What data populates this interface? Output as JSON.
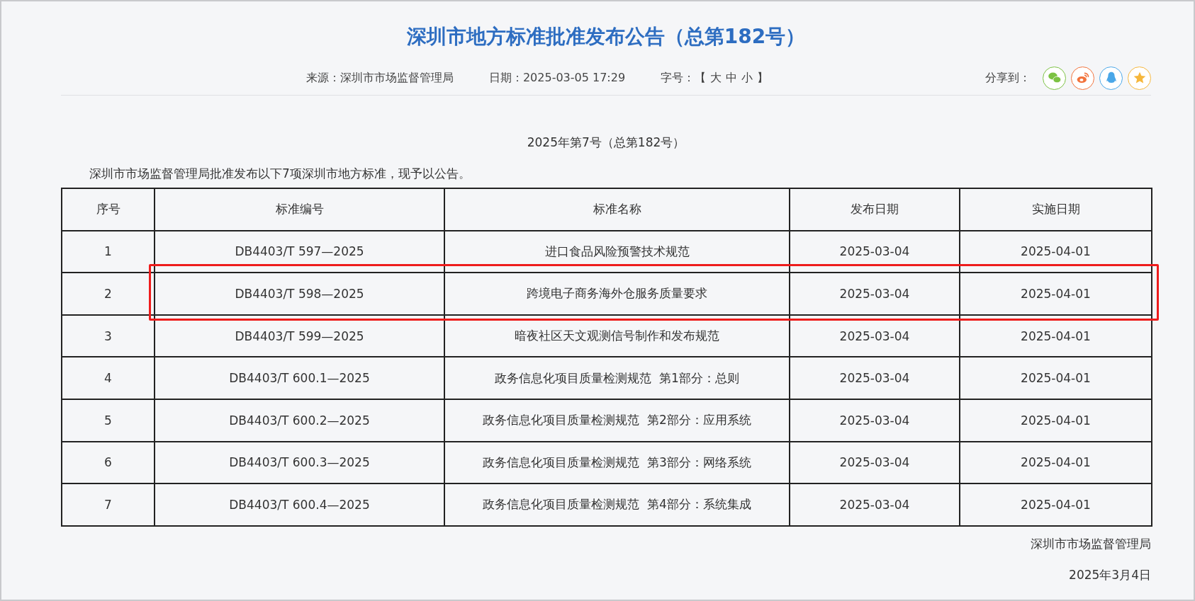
{
  "article": {
    "title": "深圳市地方标准批准发布公告（总第182号）",
    "meta": [
      {
        "label": "来源：",
        "value": "深圳市市场监督管理局"
      },
      {
        "label": "日期：",
        "value": "2025-03-05 17:29"
      }
    ],
    "font_size": {
      "label": "字号：",
      "open": "【",
      "options": [
        "大",
        "中",
        "小"
      ],
      "close": "】"
    },
    "share": {
      "label": "分享到：",
      "targets": [
        {
          "kind": "wechat",
          "color": "#7cc243"
        },
        {
          "kind": "weibo",
          "color": "#f2733c"
        },
        {
          "kind": "qq",
          "color": "#4aa7e8"
        },
        {
          "kind": "qzone",
          "color": "#f6b73c"
        }
      ]
    },
    "issue": "2025年第7号（总第182号）",
    "intro": "深圳市市场监督管理局批准发布以下7项深圳市地方标准，现予以公告。",
    "table": {
      "columns": [
        "序号",
        "标准编号",
        "标准名称",
        "发布日期",
        "实施日期"
      ],
      "rows": [
        {
          "cells": [
            "1",
            "DB4403/T 597—2025",
            "进口食品风险预警技术规范",
            "2025-03-04",
            "2025-04-01"
          ],
          "highlighted": false
        },
        {
          "cells": [
            "2",
            "DB4403/T 598—2025",
            "跨境电子商务海外仓服务质量要求",
            "2025-03-04",
            "2025-04-01"
          ],
          "highlighted": true
        },
        {
          "cells": [
            "3",
            "DB4403/T 599—2025",
            "暗夜社区天文观测信号制作和发布规范",
            "2025-03-04",
            "2025-04-01"
          ],
          "highlighted": false
        },
        {
          "cells": [
            "4",
            "DB4403/T 600.1—2025",
            "政务信息化项目质量检测规范  第1部分：总则",
            "2025-03-04",
            "2025-04-01"
          ],
          "highlighted": false
        },
        {
          "cells": [
            "5",
            "DB4403/T 600.2—2025",
            "政务信息化项目质量检测规范  第2部分：应用系统",
            "2025-03-04",
            "2025-04-01"
          ],
          "highlighted": false
        },
        {
          "cells": [
            "6",
            "DB4403/T 600.3—2025",
            "政务信息化项目质量检测规范  第3部分：网络系统",
            "2025-03-04",
            "2025-04-01"
          ],
          "highlighted": false
        },
        {
          "cells": [
            "7",
            "DB4403/T 600.4—2025",
            "政务信息化项目质量检测规范  第4部分：系统集成",
            "2025-03-04",
            "2025-04-01"
          ],
          "highlighted": false
        }
      ]
    },
    "signature": "深圳市市场监督管理局",
    "date": "2025年3月4日"
  }
}
